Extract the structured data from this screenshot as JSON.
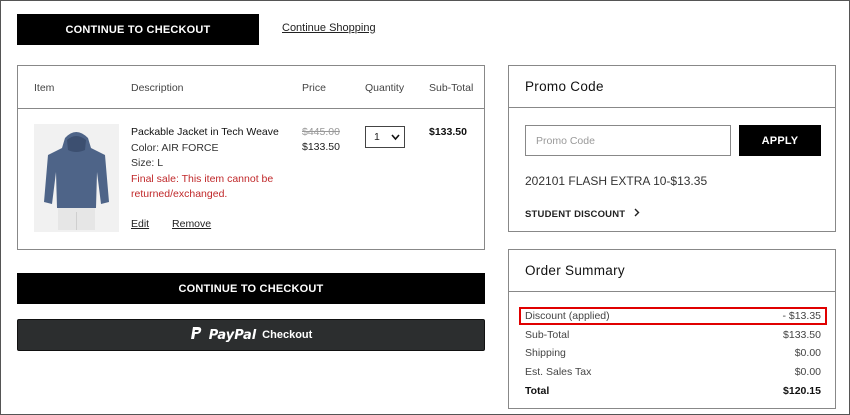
{
  "top": {
    "checkout_label": "CONTINUE TO CHECKOUT",
    "continue_shopping_label": "Continue Shopping"
  },
  "cart": {
    "headers": {
      "item": "Item",
      "description": "Description",
      "price": "Price",
      "quantity": "Quantity",
      "subtotal": "Sub-Total"
    },
    "product": {
      "name": "Packable Jacket in Tech Weave",
      "color": "Color: AIR FORCE",
      "size": "Size: L",
      "warning": "Final sale: This item cannot be returned/exchanged.",
      "original_price": "$445.00",
      "sale_price": "$133.50",
      "quantity": "1",
      "subtotal": "$133.50",
      "edit_label": "Edit",
      "remove_label": "Remove"
    }
  },
  "bottom": {
    "checkout_label": "CONTINUE TO CHECKOUT",
    "paypal_label": "PayPal",
    "paypal_checkout": "Checkout"
  },
  "promo": {
    "title": "Promo Code",
    "placeholder": "Promo Code",
    "apply_label": "APPLY",
    "applied_code": "202101 FLASH EXTRA 10-$13.35",
    "student_label": "STUDENT DISCOUNT"
  },
  "summary": {
    "title": "Order Summary",
    "rows": [
      {
        "label": "Discount (applied)",
        "value": "- $13.35"
      },
      {
        "label": "Sub-Total",
        "value": "$133.50"
      },
      {
        "label": "Shipping",
        "value": "$0.00"
      },
      {
        "label": "Est. Sales Tax",
        "value": "$0.00"
      },
      {
        "label": "Total",
        "value": "$120.15"
      }
    ]
  },
  "colors": {
    "button": "#000000",
    "paypal_button": "#2c2e2f",
    "warning": "#c0282a",
    "highlight": "#e00000"
  },
  "icons": [
    "chevron-down-icon",
    "chevron-right-icon",
    "paypal-logo-icon"
  ]
}
